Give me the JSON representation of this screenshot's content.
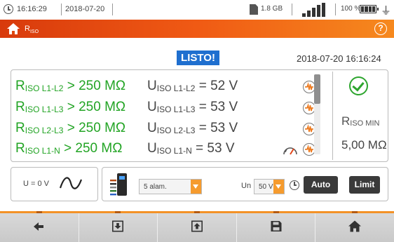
{
  "status_bar": {
    "time": "16:16:29",
    "date": "2018-07-20",
    "memory": "1.8 GB",
    "battery_percent": "100 %"
  },
  "title_bar": {
    "title_main": "R",
    "title_sub": "ISO",
    "help": "?"
  },
  "status_badge": "LISTO!",
  "datetime": "2018-07-20 16:16:24",
  "results": [
    {
      "r_main": "R",
      "r_sub": "ISO L1-L2",
      "r_value": " > 250 MΩ",
      "u_main": "U",
      "u_sub": "ISO L1-L2",
      "u_value": " = 52 V"
    },
    {
      "r_main": "R",
      "r_sub": "ISO L1-L3",
      "r_value": " > 250 MΩ",
      "u_main": "U",
      "u_sub": "ISO L1-L3",
      "u_value": " = 53 V"
    },
    {
      "r_main": "R",
      "r_sub": "ISO L2-L3",
      "r_value": " > 250 MΩ",
      "u_main": "U",
      "u_sub": "ISO L2-L3",
      "u_value": " = 53 V"
    },
    {
      "r_main": "R",
      "r_sub": "ISO L1-N",
      "r_value": "  > 250 MΩ",
      "u_main": "U",
      "u_sub": "ISO L1-N",
      "u_value": "  = 53 V"
    }
  ],
  "riso_min": {
    "label_main": "R",
    "label_sub": "ISO MIN",
    "value": "5,00 MΩ"
  },
  "voltage_box": {
    "label": "U = 0 V"
  },
  "controls": {
    "leads_select": "5 alam.",
    "un_label": "Un",
    "un_select": "50 V",
    "auto_button": "Auto",
    "limit_button": "Limit"
  },
  "colors": {
    "accent_orange": "#f05a14",
    "result_green": "#22a424",
    "status_blue": "#1f6fcf",
    "select_arrow": "#f59b2e"
  },
  "icons": [
    "clock-icon",
    "sd-card-icon",
    "signal-icon",
    "battery-icon",
    "plug-icon",
    "home-icon",
    "help-icon",
    "wave-icon",
    "gauge-icon",
    "check-icon",
    "sine-icon",
    "connector-icon",
    "timer-icon",
    "back-arrow-icon",
    "download-icon",
    "upload-icon",
    "save-icon"
  ]
}
